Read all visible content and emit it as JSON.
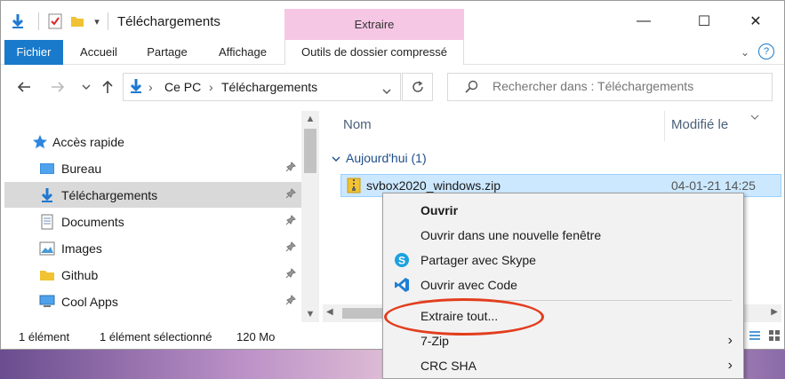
{
  "window": {
    "title": "Téléchargements",
    "contextual_tab_group": "Extraire",
    "controls": {
      "minimize": "—",
      "maximize": "☐",
      "close": "✕"
    }
  },
  "ribbon": {
    "tabs": [
      "Fichier",
      "Accueil",
      "Partage",
      "Affichage",
      "Outils de dossier compressé"
    ],
    "collapse": "⌄",
    "help": "?"
  },
  "address_bar": {
    "crumbs": [
      "Ce PC",
      "Téléchargements"
    ],
    "separator": "›"
  },
  "search": {
    "placeholder": "Rechercher dans : Téléchargements"
  },
  "nav_pane": {
    "items": [
      {
        "label": "Accès rapide",
        "icon": "star-icon"
      },
      {
        "label": "Bureau",
        "icon": "desktop-icon"
      },
      {
        "label": "Téléchargements",
        "icon": "download-icon"
      },
      {
        "label": "Documents",
        "icon": "documents-icon"
      },
      {
        "label": "Images",
        "icon": "images-icon"
      },
      {
        "label": "Github",
        "icon": "folder-icon"
      },
      {
        "label": "Cool Apps",
        "icon": "computer-icon"
      }
    ],
    "pin_glyph": "📌"
  },
  "file_list": {
    "columns": {
      "name": "Nom",
      "modified": "Modifié le"
    },
    "group_label": "Aujourd'hui (1)",
    "files": [
      {
        "name": "svbox2020_windows.zip",
        "modified": "04-01-21 14:25"
      }
    ]
  },
  "status_bar": {
    "count": "1 élément",
    "selected": "1 élément sélectionné",
    "size": "120 Mo"
  },
  "context_menu": {
    "items": [
      {
        "label": "Ouvrir",
        "icon": "",
        "bold": true
      },
      {
        "label": "Ouvrir dans une nouvelle fenêtre",
        "icon": ""
      },
      {
        "label": "Partager avec Skype",
        "icon": "skype-icon"
      },
      {
        "label": "Ouvrir avec Code",
        "icon": "vscode-icon"
      },
      {
        "label": "Extraire tout...",
        "icon": ""
      },
      {
        "label": "7-Zip",
        "icon": "",
        "submenu": true
      },
      {
        "label": "CRC SHA",
        "icon": "",
        "submenu": true
      }
    ],
    "submenu_arrow": "›"
  },
  "colors": {
    "accent": "#1979ca",
    "selection": "#cce8ff",
    "tool_tab": "#f6c7e4",
    "annotation": "#e23d1d"
  }
}
